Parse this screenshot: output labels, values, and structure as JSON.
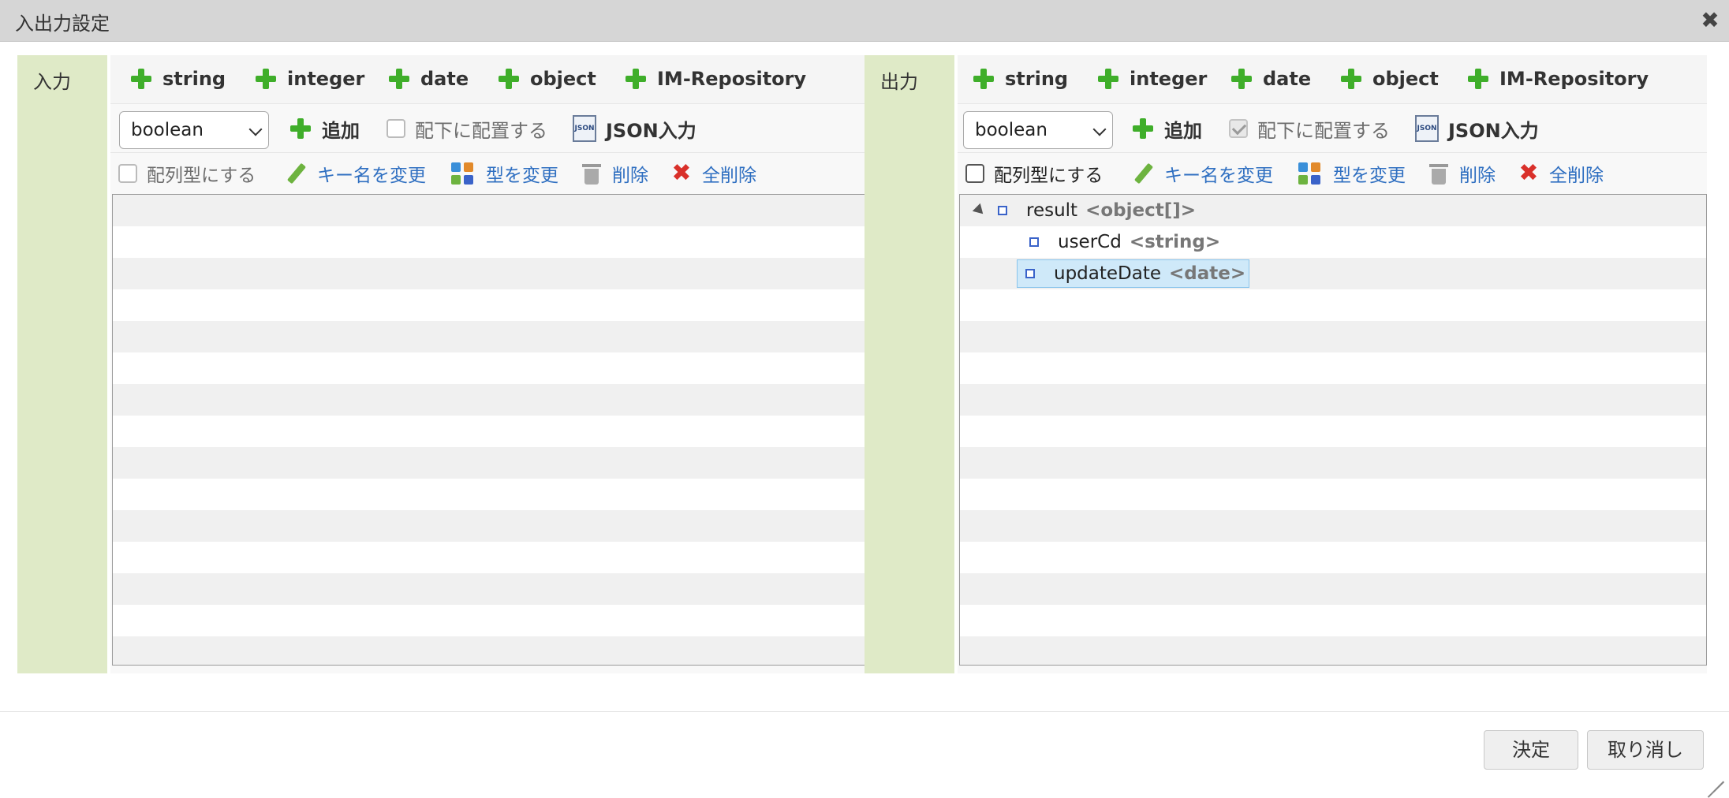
{
  "dialog": {
    "title": "入出力設定"
  },
  "type_buttons": [
    "string",
    "integer",
    "date",
    "object",
    "IM-Repository"
  ],
  "input": {
    "label": "入力",
    "select_value": "boolean",
    "add_label": "追加",
    "place_under_label": "配下に配置する",
    "place_under_checked": false,
    "json_label": "JSON入力",
    "array_label": "配列型にする",
    "actions": {
      "rename": "キー名を変更",
      "change_type": "型を変更",
      "delete": "削除",
      "delete_all": "全削除"
    },
    "tree": []
  },
  "output": {
    "label": "出力",
    "select_value": "boolean",
    "add_label": "追加",
    "place_under_label": "配下に配置する",
    "place_under_checked": true,
    "json_label": "JSON入力",
    "array_label": "配列型にする",
    "actions": {
      "rename": "キー名を変更",
      "change_type": "型を変更",
      "delete": "削除",
      "delete_all": "全削除"
    },
    "tree": [
      {
        "name": "result",
        "type": "<object[]>",
        "expanded": true
      },
      {
        "name": "userCd",
        "type": "<string>"
      },
      {
        "name": "updateDate",
        "type": "<date>",
        "selected": true
      }
    ]
  },
  "footer": {
    "ok": "決定",
    "cancel": "取り消し"
  },
  "colors": {
    "accent_green": "#3fae2a",
    "label_bg": "#dfeac7",
    "link_blue": "#2f6fc1",
    "selection": "#cfe9f9"
  }
}
